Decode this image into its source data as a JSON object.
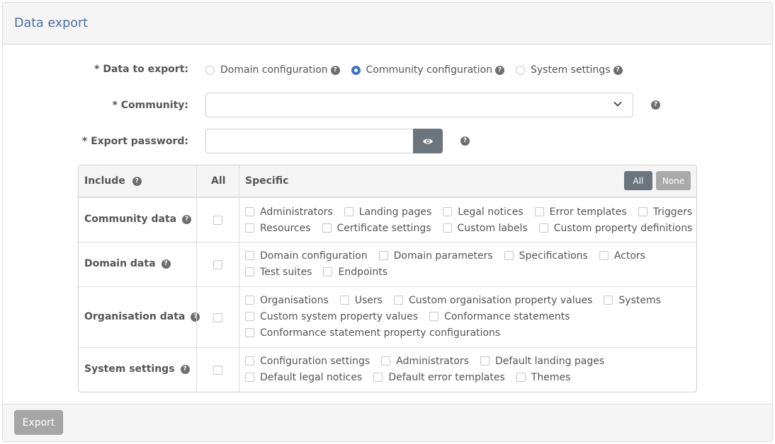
{
  "panel": {
    "title": "Data export",
    "export_label": "Export"
  },
  "form": {
    "data_to_export_label": "* Data to export:",
    "options": [
      {
        "label": "Domain configuration",
        "selected": false
      },
      {
        "label": "Community configuration",
        "selected": true
      },
      {
        "label": "System settings",
        "selected": false
      }
    ],
    "community_label": "* Community:",
    "community_value": "",
    "password_label": "* Export password:",
    "password_value": "",
    "help_glyph": "?"
  },
  "table": {
    "col_include": "Include",
    "col_all": "All",
    "col_specific": "Specific",
    "btn_all": "All",
    "btn_none": "None",
    "rows": [
      {
        "label": "Community data",
        "lines": [
          [
            "Administrators",
            "Landing pages",
            "Legal notices",
            "Error templates",
            "Triggers"
          ],
          [
            "Resources",
            "Certificate settings",
            "Custom labels",
            "Custom property definitions"
          ]
        ]
      },
      {
        "label": "Domain data",
        "lines": [
          [
            "Domain configuration",
            "Domain parameters",
            "Specifications",
            "Actors"
          ],
          [
            "Test suites",
            "Endpoints"
          ]
        ]
      },
      {
        "label": "Organisation data",
        "lines": [
          [
            "Organisations",
            "Users",
            "Custom organisation property values",
            "Systems"
          ],
          [
            "Custom system property values",
            "Conformance statements"
          ],
          [
            "Conformance statement property configurations"
          ]
        ]
      },
      {
        "label": "System settings",
        "lines": [
          [
            "Configuration settings",
            "Administrators",
            "Default landing pages"
          ],
          [
            "Default legal notices",
            "Default error templates",
            "Themes"
          ]
        ]
      }
    ]
  },
  "colors": {
    "title": "#4c6fa3",
    "radio_selected": "#3a75c4",
    "button_dark": "#6c757d",
    "button_disabled": "#a6a6a6"
  }
}
